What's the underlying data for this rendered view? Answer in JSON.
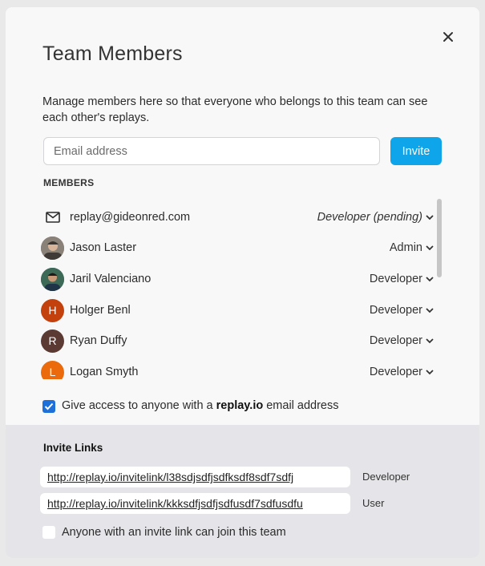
{
  "dialog": {
    "title": "Team Members",
    "description": "Manage members here so that everyone who belongs to this team can see each other's replays.",
    "email_placeholder": "Email address",
    "invite_label": "Invite",
    "members_heading": "MEMBERS",
    "close_icon": "close-icon"
  },
  "members": [
    {
      "name": "replay@gideonred.com",
      "role": "Developer (pending)",
      "avatar": "mail-icon",
      "pending": true
    },
    {
      "name": "Jason Laster",
      "role": "Admin",
      "avatar": "photo",
      "color": "#5b5348"
    },
    {
      "name": "Jaril Valenciano",
      "role": "Developer",
      "avatar": "photo",
      "color": "#2f4a5c"
    },
    {
      "name": "Holger Benl",
      "role": "Developer",
      "initial": "H",
      "color": "#c2410c"
    },
    {
      "name": "Ryan Duffy",
      "role": "Developer",
      "initial": "R",
      "color": "#5b3a34"
    },
    {
      "name": "Logan Smyth",
      "role": "Developer",
      "initial": "L",
      "color": "#ea6a0c"
    }
  ],
  "access": {
    "label_prefix": "Give access to anyone with a ",
    "label_domain": "replay.io",
    "label_suffix": " email address",
    "checked": true
  },
  "invite_links": {
    "title": "Invite Links",
    "links": [
      {
        "url": "http://replay.io/invitelink/l38sdjsdfjsdfksdf8sdf7sdfj",
        "role": "Developer"
      },
      {
        "url": "http://replay.io/invitelink/kkksdfjsdfjsdfusdf7sdfusdfu",
        "role": "User"
      }
    ],
    "join_label": "Anyone with an invite link can join this team",
    "join_checked": false
  },
  "colors": {
    "accent": "#0ea5ea",
    "checkbox": "#1f6fd9",
    "footer_bg": "#e5e5e9"
  }
}
